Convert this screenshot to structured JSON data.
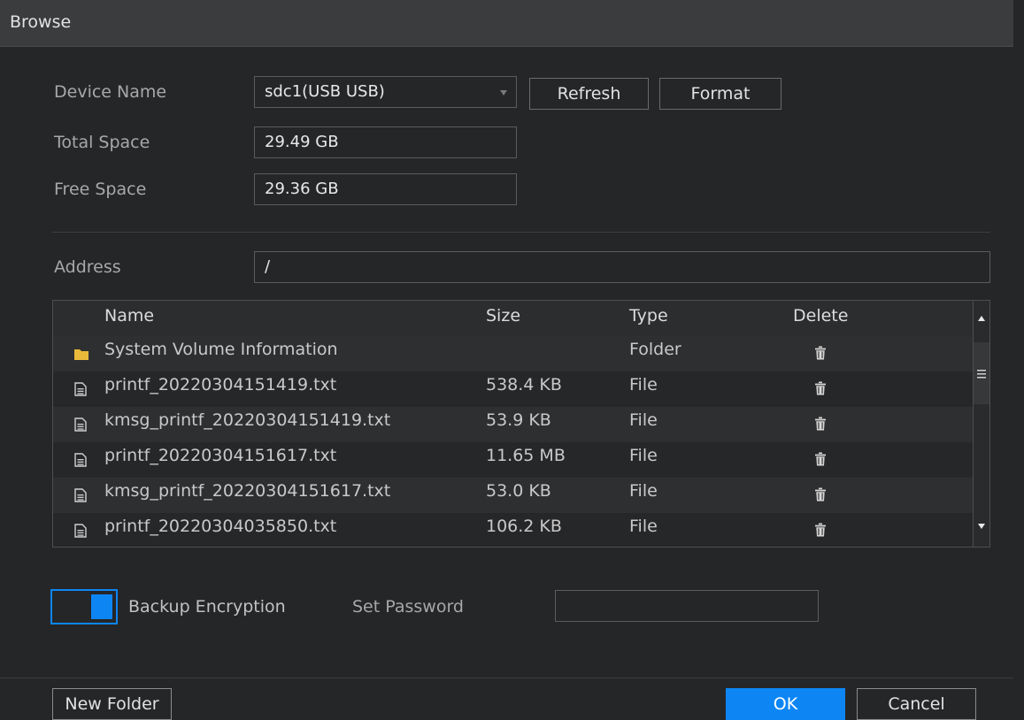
{
  "dialog": {
    "title": "Browse"
  },
  "device": {
    "name_label": "Device Name",
    "name_value": "sdc1(USB USB)",
    "refresh_label": "Refresh",
    "format_label": "Format",
    "total_label": "Total Space",
    "total_value": "29.49 GB",
    "free_label": "Free Space",
    "free_value": "29.36 GB"
  },
  "address": {
    "label": "Address",
    "value": "/"
  },
  "table": {
    "headers": {
      "name": "Name",
      "size": "Size",
      "type": "Type",
      "delete": "Delete"
    },
    "rows": [
      {
        "name": "System Volume Information",
        "size": "",
        "type": "Folder",
        "icon": "folder-icon"
      },
      {
        "name": "printf_20220304151419.txt",
        "size": "538.4 KB",
        "type": "File",
        "icon": "file-icon"
      },
      {
        "name": "kmsg_printf_20220304151419.txt",
        "size": "53.9 KB",
        "type": "File",
        "icon": "file-icon"
      },
      {
        "name": "printf_20220304151617.txt",
        "size": "11.65 MB",
        "type": "File",
        "icon": "file-icon"
      },
      {
        "name": "kmsg_printf_20220304151617.txt",
        "size": "53.0 KB",
        "type": "File",
        "icon": "file-icon"
      },
      {
        "name": "printf_20220304035850.txt",
        "size": "106.2 KB",
        "type": "File",
        "icon": "file-icon"
      }
    ]
  },
  "encryption": {
    "label": "Backup Encryption",
    "enabled": true,
    "password_label": "Set Password",
    "password_value": ""
  },
  "footer": {
    "new_folder_label": "New Folder",
    "ok_label": "OK",
    "cancel_label": "Cancel"
  },
  "colors": {
    "accent": "#0d86f4",
    "background": "#252628",
    "titlebar": "#3b3c3e"
  }
}
